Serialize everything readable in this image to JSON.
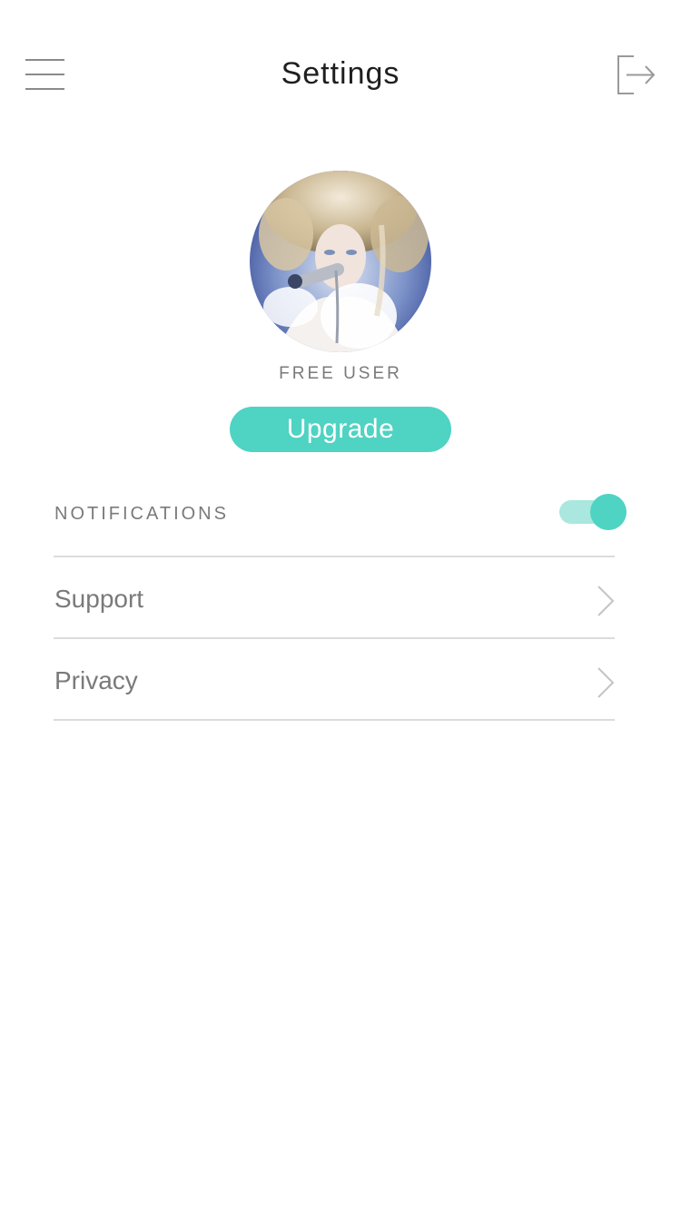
{
  "header": {
    "title": "Settings",
    "menu_icon": "hamburger-menu-icon",
    "logout_icon": "logout-icon"
  },
  "profile": {
    "status": "FREE USER",
    "upgrade_label": "Upgrade"
  },
  "settings": {
    "notifications": {
      "label": "NOTIFICATIONS",
      "enabled": true
    },
    "items": [
      {
        "label": "Support",
        "icon": "chevron-right-icon"
      },
      {
        "label": "Privacy",
        "icon": "chevron-right-icon"
      }
    ]
  },
  "colors": {
    "accent": "#4fd3c2",
    "accent_light": "#a9e7df",
    "text_muted": "#7a7a7a",
    "divider": "#dcdcdc"
  }
}
